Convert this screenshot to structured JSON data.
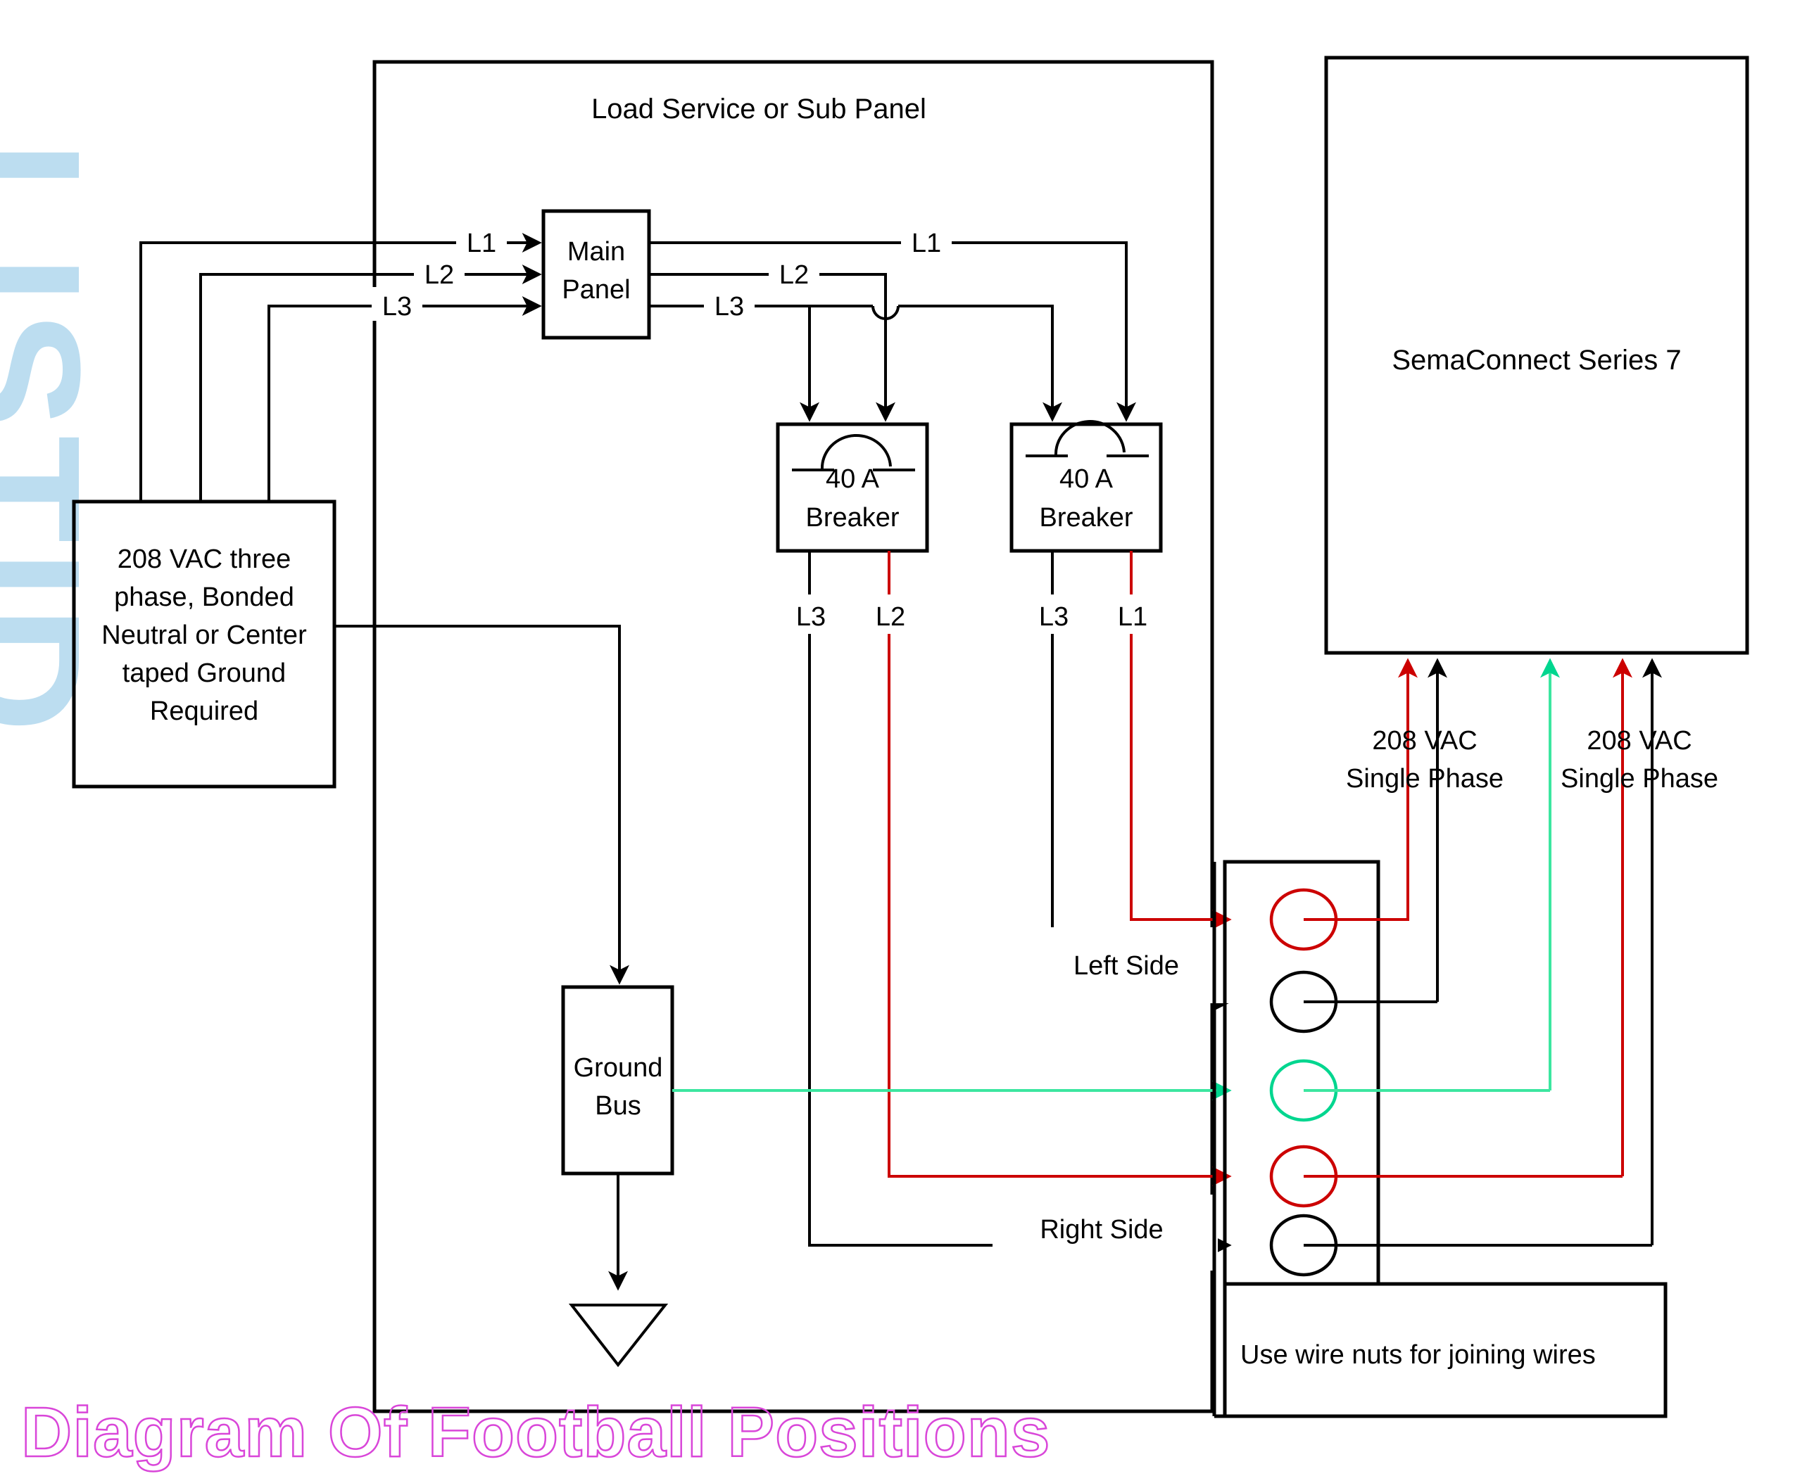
{
  "diagram": {
    "title_panel": "Load Service or Sub Panel",
    "source_box": {
      "lines": [
        "208 VAC three",
        "phase, Bonded",
        "Neutral or Center",
        "taped Ground",
        "Required"
      ]
    },
    "main_panel": {
      "line1": "Main",
      "line2": "Panel"
    },
    "feed_labels": {
      "l1": "L1",
      "l2": "L2",
      "l3": "L3"
    },
    "panel_out_labels": {
      "l1": "L1",
      "l2": "L2",
      "l3": "L3"
    },
    "breaker_left": {
      "rating": "40 A",
      "name": "Breaker"
    },
    "breaker_right": {
      "rating": "40 A",
      "name": "Breaker"
    },
    "breaker_out_labels": {
      "left_black": "L3",
      "left_red": "L2",
      "right_black": "L3",
      "right_red": "L1"
    },
    "ground_bus": {
      "line1": "Ground",
      "line2": "Bus"
    },
    "side_labels": {
      "left": "Left Side",
      "right": "Right Side"
    },
    "evse": {
      "name": "SemaConnect Series 7"
    },
    "supply_labels": {
      "left_l1": "208 VAC",
      "left_l2": "Single Phase",
      "right_l1": "208 VAC",
      "right_l2": "Single Phase"
    },
    "wire_nut_note": "Use wire nuts for joining wires",
    "wire_nuts": [
      {
        "index": 1,
        "color": "#cc0000",
        "role": "line-red-left"
      },
      {
        "index": 2,
        "color": "#000000",
        "role": "neutral-black-left"
      },
      {
        "index": 3,
        "color": "#00d68f",
        "role": "ground-green"
      },
      {
        "index": 4,
        "color": "#cc0000",
        "role": "line-red-right"
      },
      {
        "index": 5,
        "color": "#000000",
        "role": "neutral-black-right"
      }
    ],
    "colors": {
      "line_black": "#000000",
      "line_red": "#cc0000",
      "line_green": "#3ce6a0",
      "watermark_bottom": "#d946d9",
      "watermark_side": "#bcddf0"
    }
  },
  "watermarks": {
    "bottom_text": "Diagram Of Football Positions",
    "side_text": "LISTID"
  }
}
